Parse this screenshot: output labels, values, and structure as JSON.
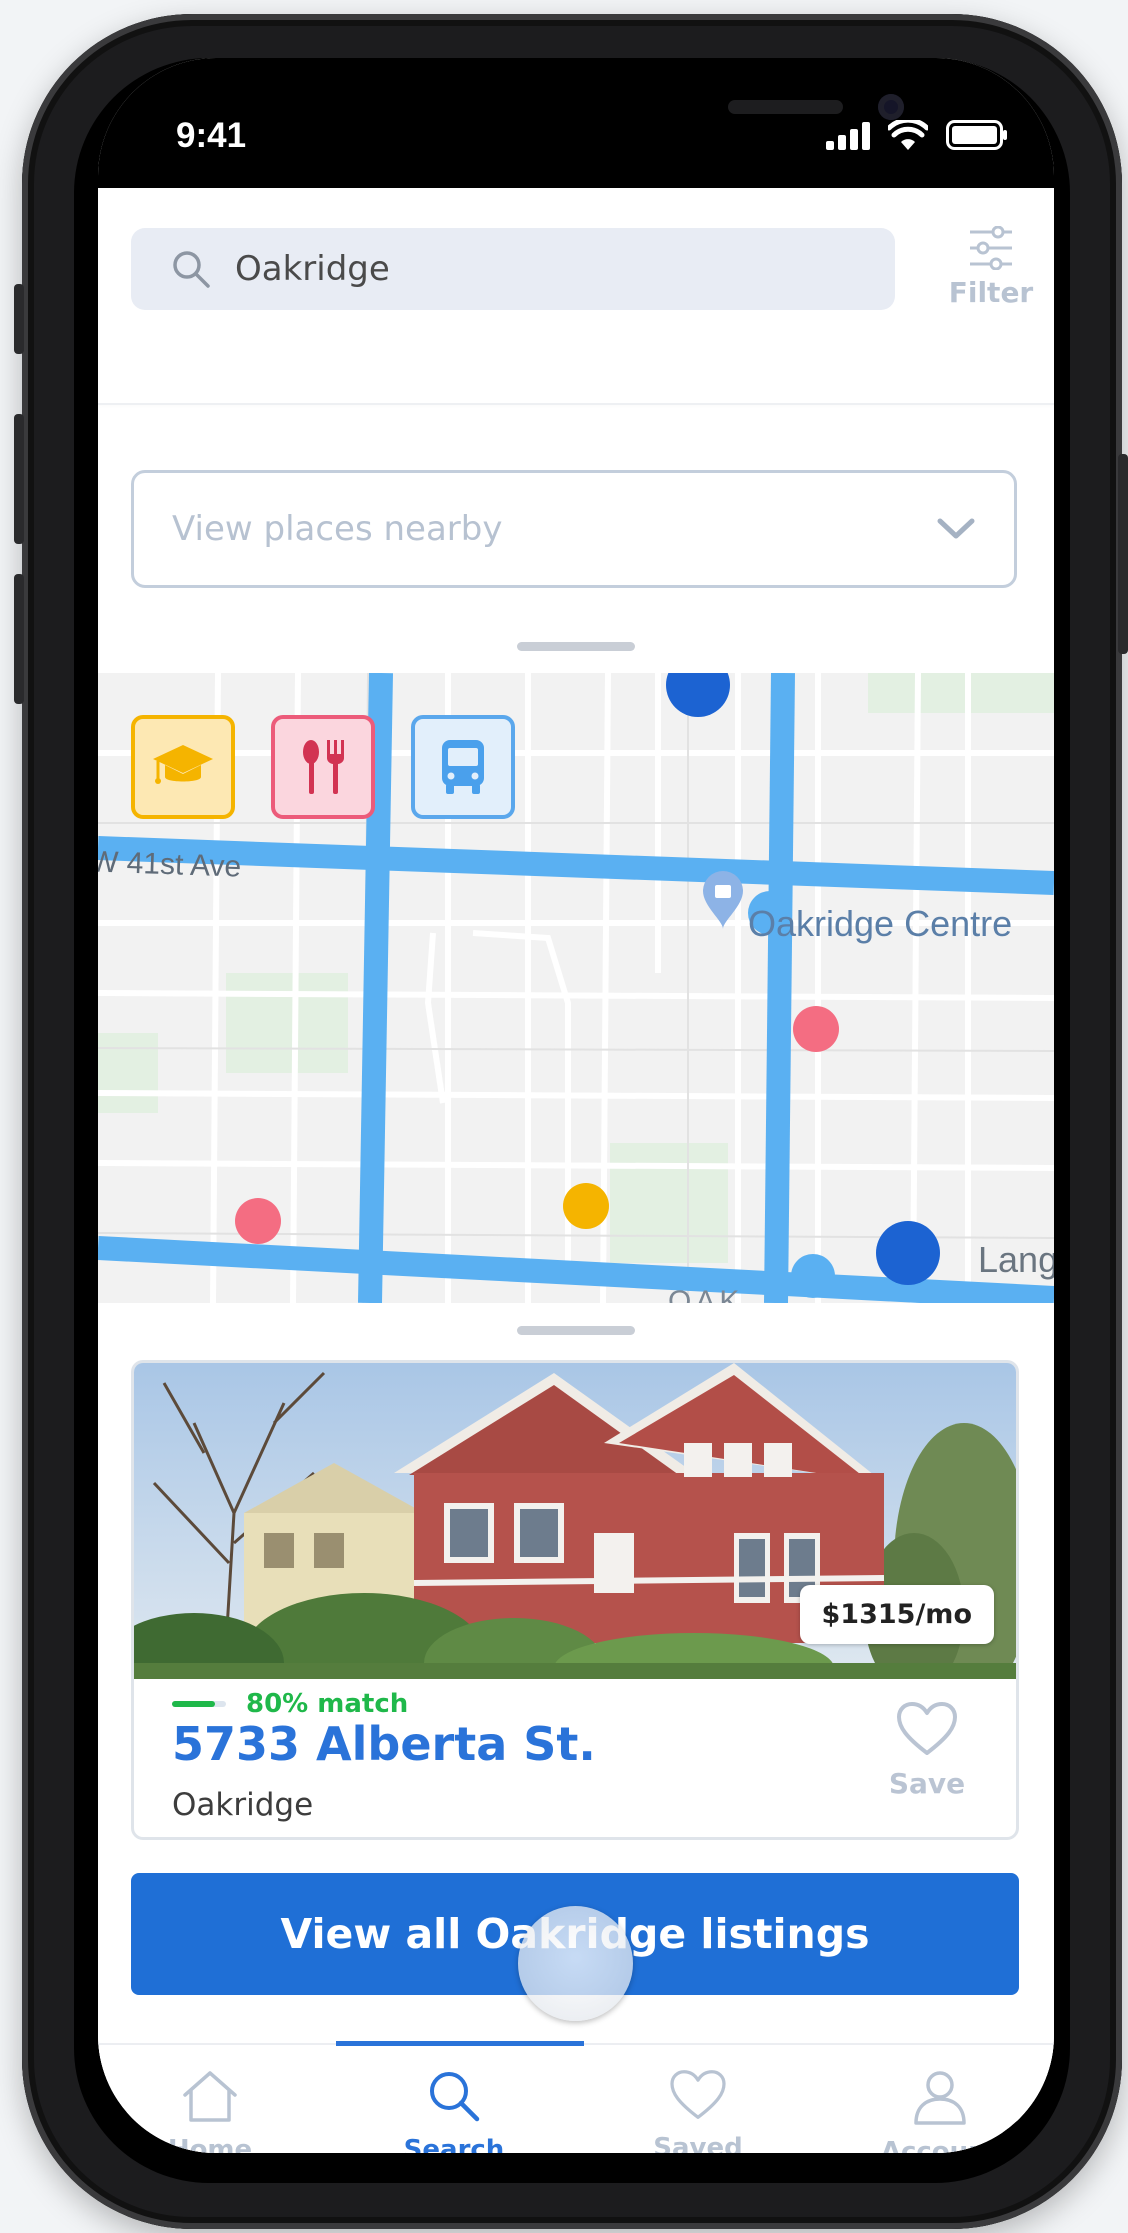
{
  "status_bar": {
    "time": "9:41"
  },
  "search": {
    "value": "Oakridge",
    "placeholder": "Oakridge",
    "filter_label": "Filter"
  },
  "nearby": {
    "selected": "View places nearby"
  },
  "map": {
    "labels": {
      "street1": "W 41st Ave",
      "place": "Oakridge Centre",
      "right": "Lang",
      "bottom": "OAK"
    },
    "categories": [
      {
        "name": "schools",
        "icon": "graduation-cap-icon",
        "color": "#f5b400"
      },
      {
        "name": "restaurants",
        "icon": "fork-spoon-icon",
        "color": "#ec5b7a"
      },
      {
        "name": "transit",
        "icon": "bus-icon",
        "color": "#5aa7ec"
      }
    ],
    "pin_colors": {
      "school": "#f5b400",
      "food": "#f46d82",
      "transit": "#1c63d2"
    }
  },
  "listing": {
    "price": "$1315/mo",
    "match": "80% match",
    "match_fraction": 0.8,
    "address": "5733 Alberta St.",
    "neighborhood": "Oakridge",
    "save_label": "Save"
  },
  "cta": {
    "label": "View all Oakridge listings"
  },
  "tabs": [
    {
      "label": "Home",
      "icon": "home-icon"
    },
    {
      "label": "Search",
      "icon": "search-icon",
      "active": true
    },
    {
      "label": "Saved",
      "icon": "heart-icon"
    },
    {
      "label": "Account",
      "icon": "person-icon"
    }
  ],
  "colors": {
    "accent": "#2a73d9",
    "match_green": "#1fb84a",
    "road_blue": "#5ab0f2"
  }
}
